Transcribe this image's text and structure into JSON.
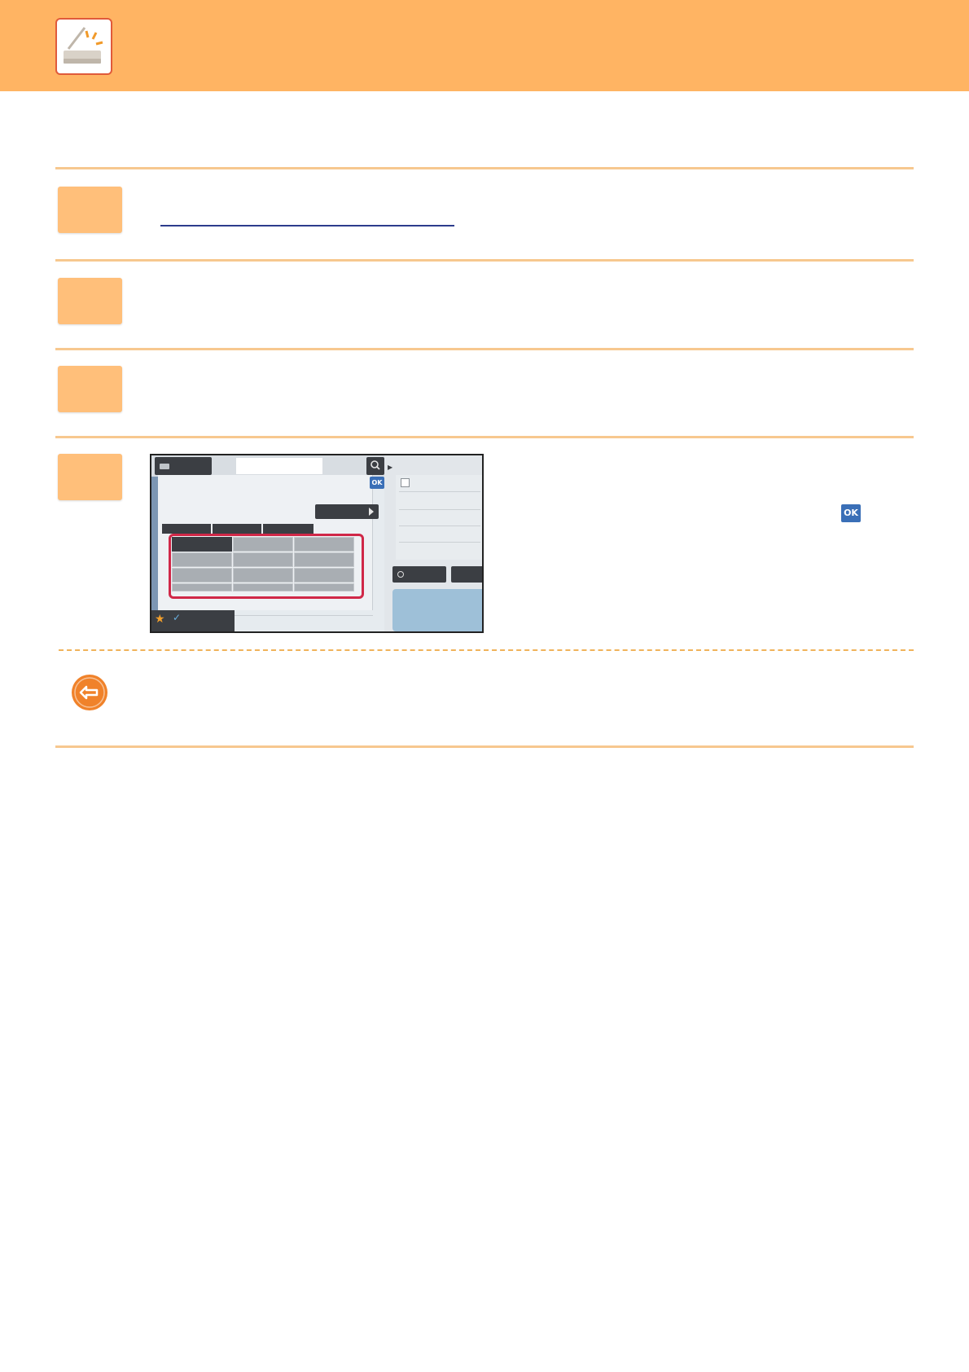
{
  "header": {
    "icon": "scanner-icon",
    "title": ""
  },
  "steps": [
    {
      "number": "",
      "text": ""
    },
    {
      "number": "",
      "text": ""
    },
    {
      "number": "",
      "text": ""
    },
    {
      "number": "",
      "text": ""
    }
  ],
  "step4": {
    "screenshot": {
      "ok_label": "OK",
      "grid_rows": 3,
      "grid_cols": 3
    },
    "inline_ok_label": "OK"
  },
  "note": {
    "icon": "return-arrow-icon",
    "text": ""
  },
  "colors": {
    "header_bg": "#ffb463",
    "step_box": "#ffbf7a",
    "rule": "#f7c88f",
    "highlight": "#d02848",
    "ok_blue": "#3a6fb7"
  }
}
